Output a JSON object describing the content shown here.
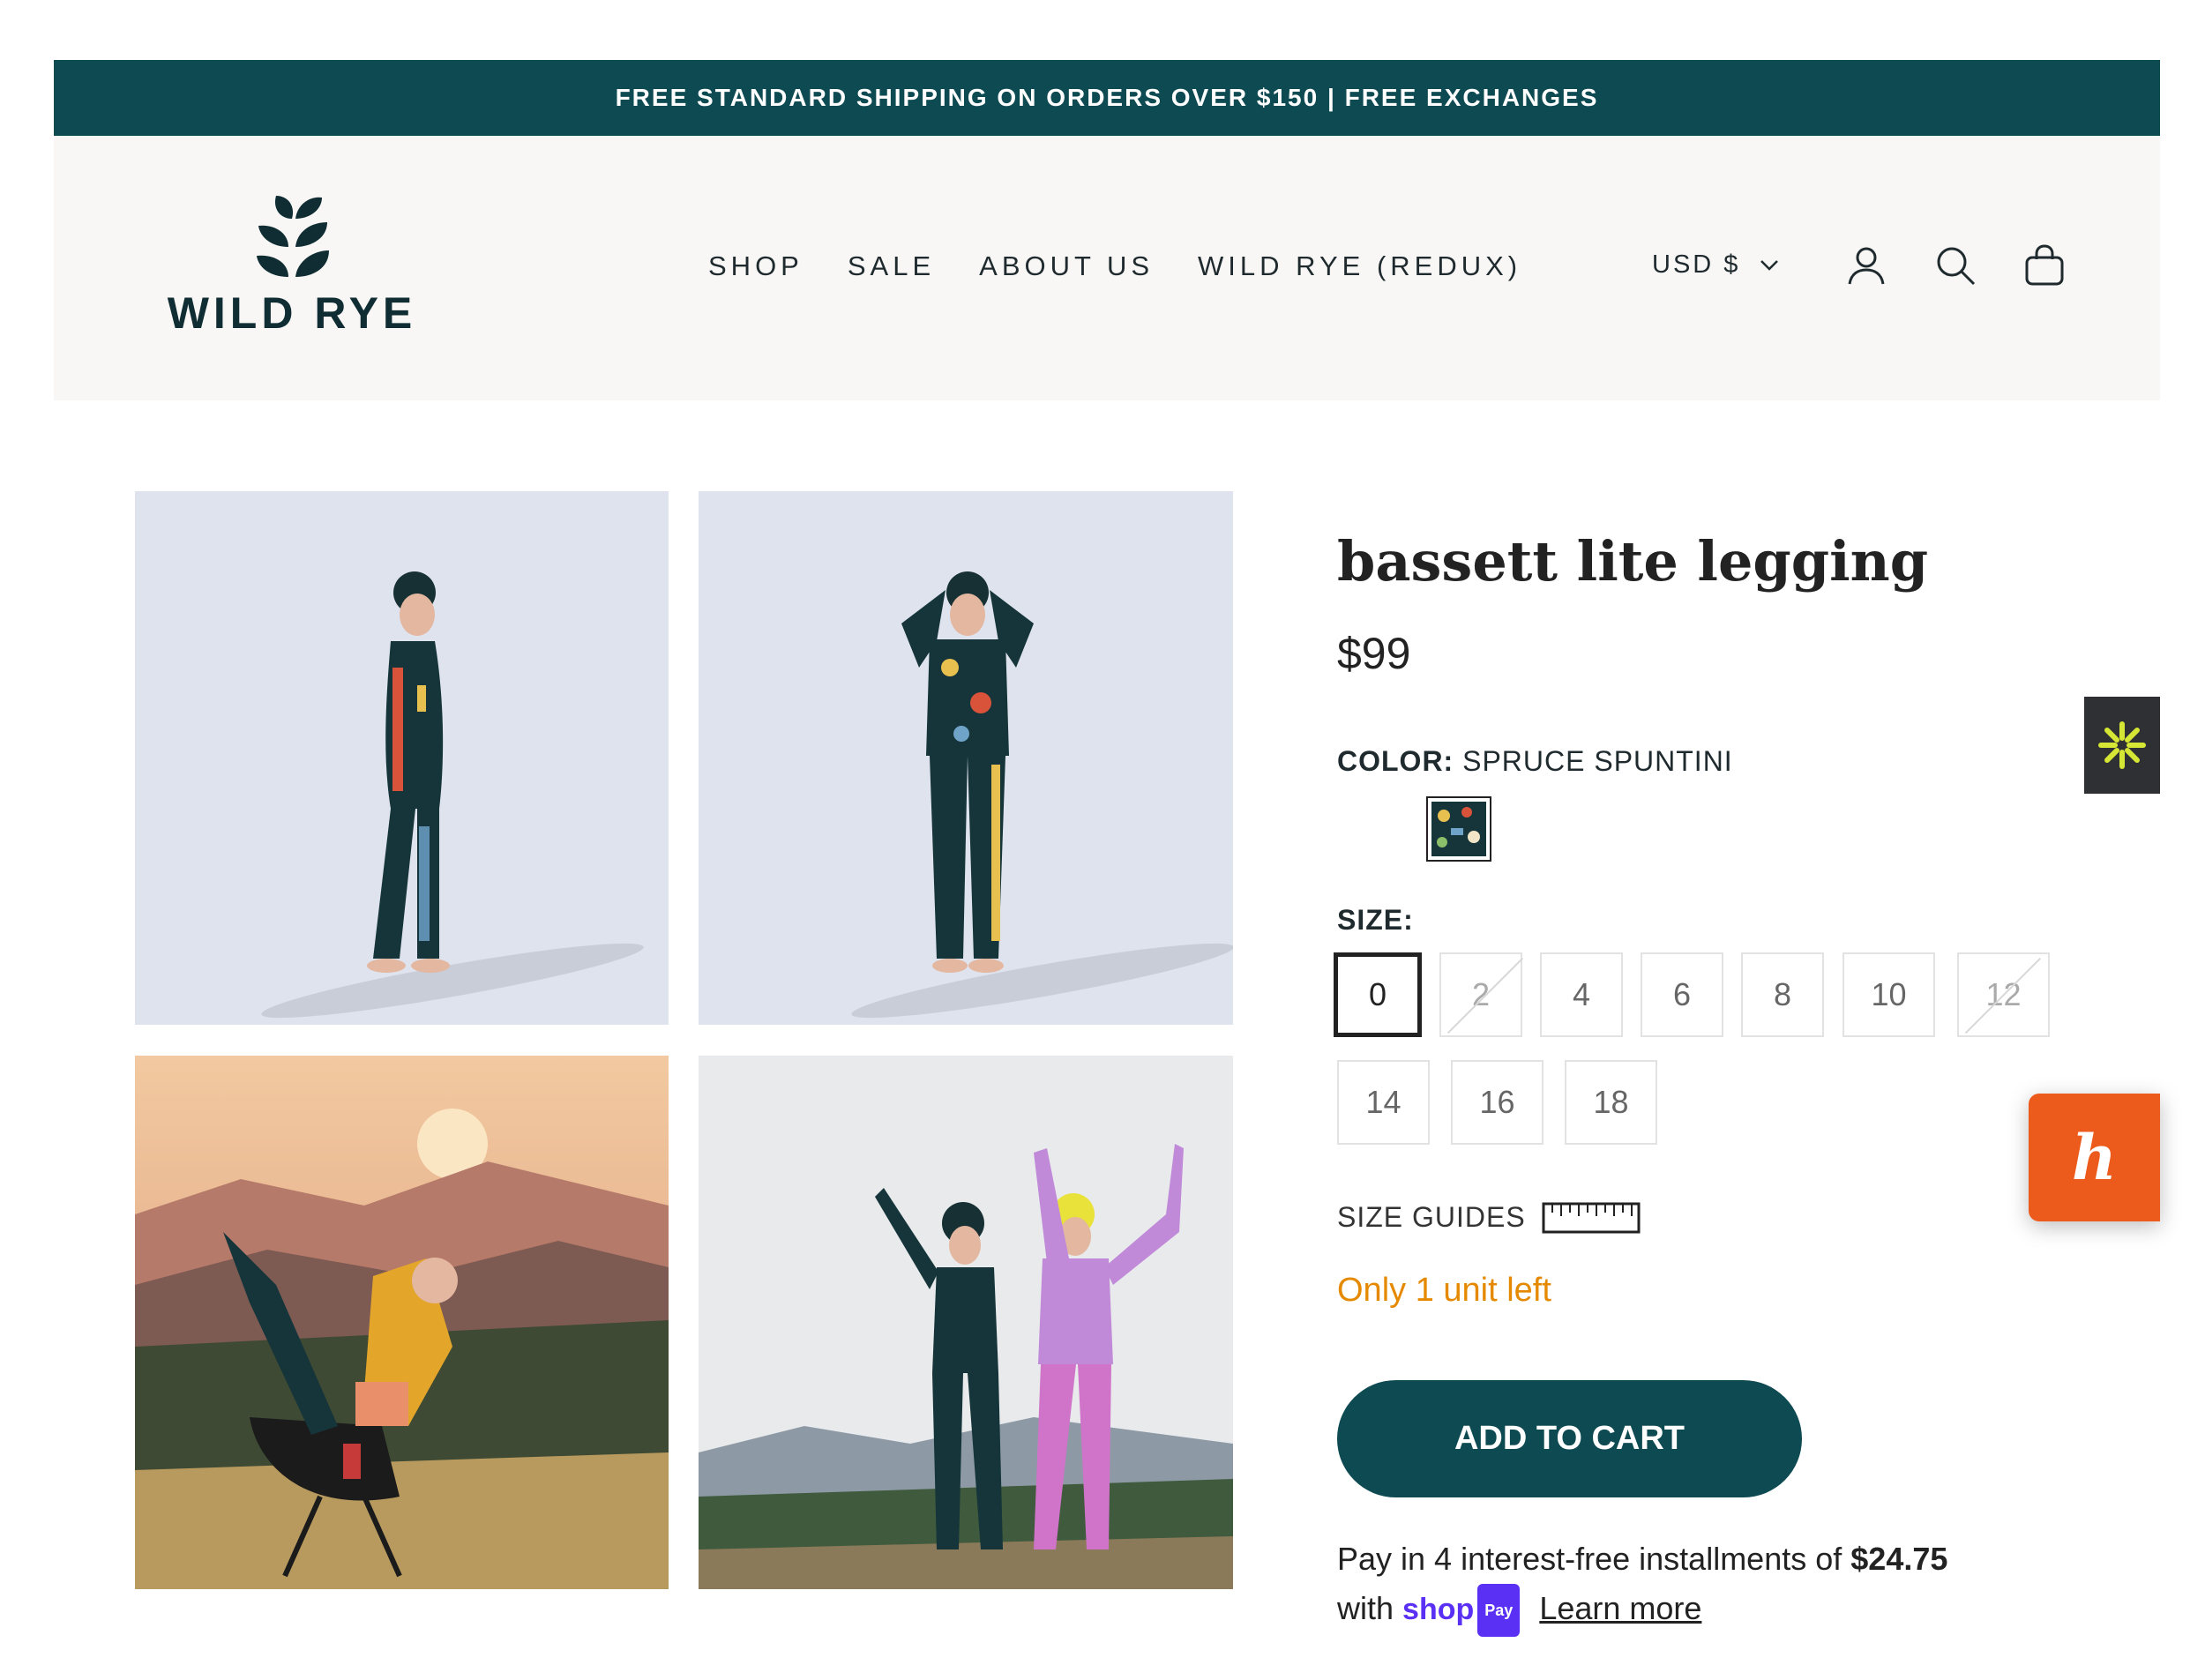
{
  "announcement": "FREE STANDARD SHIPPING ON ORDERS OVER $150 | FREE EXCHANGES",
  "brand": {
    "name": "WILD RYE"
  },
  "nav": {
    "items": [
      "SHOP",
      "SALE",
      "ABOUT US",
      "WILD RYE (REDUX)"
    ]
  },
  "header": {
    "currency": "USD $",
    "icons": [
      "account-icon",
      "search-icon",
      "cart-bag-icon"
    ]
  },
  "product": {
    "title": "bassett lite legging",
    "price": "$99",
    "color_label": "COLOR:",
    "color_value": "SPRUCE SPUNTINI",
    "size_label": "SIZE:",
    "sizes": [
      {
        "label": "0",
        "state": "selected"
      },
      {
        "label": "2",
        "state": "sold-out"
      },
      {
        "label": "4",
        "state": "available"
      },
      {
        "label": "6",
        "state": "available"
      },
      {
        "label": "8",
        "state": "available"
      },
      {
        "label": "10",
        "state": "available"
      },
      {
        "label": "12",
        "state": "sold-out"
      },
      {
        "label": "14",
        "state": "available"
      },
      {
        "label": "16",
        "state": "available"
      },
      {
        "label": "18",
        "state": "available"
      }
    ],
    "size_guides": "SIZE GUIDES",
    "stock": "Only 1 unit left",
    "add_to_cart": "ADD TO CART",
    "installments": {
      "prefix": "Pay in 4 interest-free installments of",
      "amount": "$24.75",
      "with": "with",
      "shop": "shop",
      "pay": "Pay",
      "learn_more": "Learn more"
    }
  },
  "colors": {
    "brand_teal": "#0e4a52",
    "stock_orange": "#e58a00",
    "shop_pay_purple": "#5a31f4",
    "widget_orange": "#ec5a1c"
  }
}
